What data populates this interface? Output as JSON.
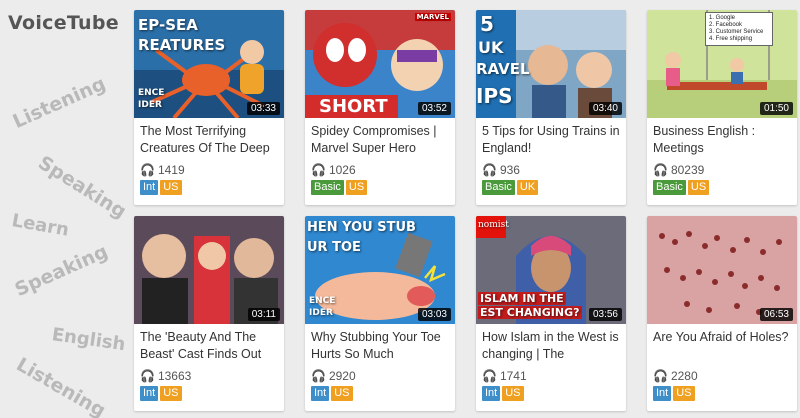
{
  "logo": "VoiceTube",
  "side_words": [
    "Listening",
    "Speaking",
    "Learn",
    "Speaking",
    "English",
    "Listening"
  ],
  "play_icon": "headphones-icon",
  "videos": [
    {
      "title": "The Most Terrifying Creatures Of The Deep",
      "duration": "03:33",
      "views": "1419",
      "level": "Int",
      "accent": "US",
      "thumb_text": [
        "EP-SEA",
        "REATURES",
        "ENCE",
        "IDER"
      ]
    },
    {
      "title": "Spidey Compromises | Marvel Super Hero",
      "duration": "03:52",
      "views": "1026",
      "level": "Basic",
      "accent": "US",
      "thumb_text": [
        "SHORT",
        "MARVEL"
      ]
    },
    {
      "title": "5 Tips for Using Trains in England!",
      "duration": "03:40",
      "views": "936",
      "level": "Basic",
      "accent": "UK",
      "thumb_text": [
        "5",
        "UK",
        "RAVEL",
        "IPS"
      ]
    },
    {
      "title": "Business English : Meetings",
      "duration": "01:50",
      "views": "80239",
      "level": "Basic",
      "accent": "US",
      "thumb_text": [
        "1. Google",
        "2. Facebook",
        "3. Customer Service",
        "4. Free shipping"
      ]
    },
    {
      "title": "The 'Beauty And The Beast' Cast Finds Out",
      "duration": "03:11",
      "views": "13663",
      "level": "Int",
      "accent": "US",
      "thumb_text": []
    },
    {
      "title": "Why Stubbing Your Toe Hurts So Much",
      "duration": "03:03",
      "views": "2920",
      "level": "Int",
      "accent": "US",
      "thumb_text": [
        "HEN YOU STUB",
        "UR TOE",
        "ENCE",
        "IDER"
      ]
    },
    {
      "title": "How Islam in the West is changing | The",
      "duration": "03:56",
      "views": "1741",
      "level": "Int",
      "accent": "US",
      "thumb_text": [
        "nomist",
        "ISLAM IN THE",
        "EST CHANGING?"
      ]
    },
    {
      "title": "Are You Afraid of Holes?",
      "duration": "06:53",
      "views": "2280",
      "level": "Int",
      "accent": "US",
      "thumb_text": []
    }
  ],
  "colors": {
    "int": "#3d8ec9",
    "basic": "#4a9a3c",
    "accent": "#f0a020"
  }
}
